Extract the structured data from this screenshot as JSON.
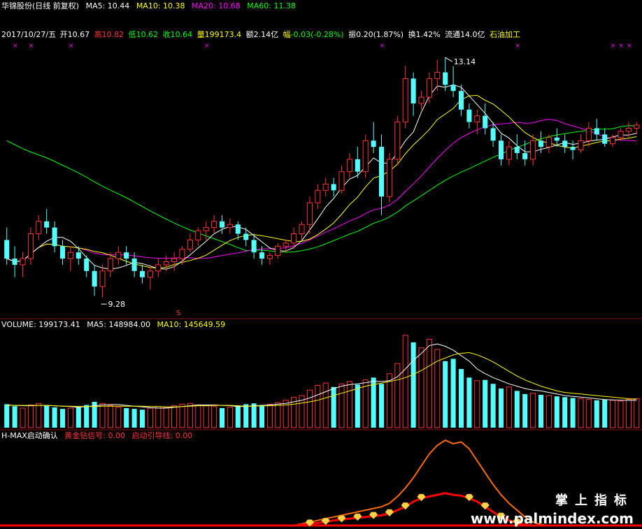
{
  "header": {
    "stock_title": "华锦股份(日线 前复权)",
    "ma5": "MA5: 10.44",
    "ma10": "MA10: 10.38",
    "ma20": "MA20: 10.68",
    "ma60": "MA60: 11.38"
  },
  "info_bar": {
    "date": "2017/10/27/五",
    "open_label": "开",
    "open": "10.67",
    "high_label": "高",
    "high": "10.82",
    "low_label": "低",
    "low": "10.62",
    "close_label": "收",
    "close": "10.64",
    "vol_label": "量",
    "vol": "199173.4",
    "amount_label": "额",
    "amount": "2.14亿",
    "change_label": "幅",
    "change": "-0.03(-0.28%)",
    "amp_label": "振",
    "amp": "0.20(1.87%)",
    "turnover_label": "换",
    "turnover": "1.42%",
    "float_label": "流通",
    "float": "14.0亿",
    "sector": "石油加工"
  },
  "volume_header": {
    "volume": "VOLUME: 199173.41",
    "ma5": "MA5: 148984.00",
    "ma10": "MA10: 145649.59"
  },
  "indicator_header": {
    "name": "H-MAX启动确认",
    "gold": "黄金钻信号: 0.00",
    "guide": "启动引导线: 0.00"
  },
  "annotations": {
    "high_marker": "13.14",
    "low_marker": "9.28",
    "s_marker": "S",
    "x_marker": "×"
  },
  "watermark": {
    "cn": "掌上指标",
    "url": "www.palmindex.com"
  },
  "colors": {
    "up": "#ff3232",
    "down": "#54ffff",
    "ma5": "#ffffff",
    "ma10": "#ffff00",
    "ma20": "#ff00ff",
    "ma60": "#00ff00",
    "guide_orange": "#ff6a00",
    "guide_red": "#ff0000",
    "diamond": "#ffd24a",
    "x_mark": "#ff00ff"
  },
  "chart_data": [
    {
      "type": "candlestick",
      "title": "华锦股份(日线 前复权)",
      "extremes": {
        "high": 13.14,
        "low": 9.28
      },
      "ohlc": [
        [
          10.2,
          10.4,
          9.8,
          9.9
        ],
        [
          9.9,
          10.1,
          9.6,
          9.8
        ],
        [
          9.8,
          10.0,
          9.6,
          9.9
        ],
        [
          9.9,
          10.4,
          9.8,
          10.3
        ],
        [
          10.3,
          10.6,
          10.2,
          10.5
        ],
        [
          10.5,
          10.7,
          10.3,
          10.4
        ],
        [
          10.4,
          10.5,
          10.0,
          10.1
        ],
        [
          10.1,
          10.2,
          9.8,
          9.9
        ],
        [
          9.9,
          10.1,
          9.7,
          10.0
        ],
        [
          10.0,
          10.1,
          9.8,
          9.9
        ],
        [
          9.9,
          9.95,
          9.6,
          9.7
        ],
        [
          9.7,
          9.8,
          9.3,
          9.45
        ],
        [
          9.45,
          9.8,
          9.28,
          9.7
        ],
        [
          9.7,
          10.0,
          9.6,
          9.9
        ],
        [
          9.9,
          10.1,
          9.8,
          10.0
        ],
        [
          10.0,
          10.1,
          9.8,
          9.9
        ],
        [
          9.9,
          10.0,
          9.6,
          9.7
        ],
        [
          9.7,
          9.8,
          9.5,
          9.6
        ],
        [
          9.6,
          9.8,
          9.4,
          9.7
        ],
        [
          9.7,
          9.9,
          9.6,
          9.8
        ],
        [
          9.8,
          9.95,
          9.7,
          9.85
        ],
        [
          9.85,
          10.0,
          9.7,
          9.9
        ],
        [
          9.9,
          10.1,
          9.8,
          10.05
        ],
        [
          10.05,
          10.3,
          10.0,
          10.2
        ],
        [
          10.2,
          10.4,
          10.1,
          10.35
        ],
        [
          10.35,
          10.5,
          10.2,
          10.4
        ],
        [
          10.4,
          10.6,
          10.3,
          10.5
        ],
        [
          10.5,
          10.6,
          10.3,
          10.4
        ],
        [
          10.4,
          10.55,
          10.3,
          10.45
        ],
        [
          10.45,
          10.5,
          10.2,
          10.3
        ],
        [
          10.3,
          10.4,
          10.1,
          10.2
        ],
        [
          10.2,
          10.3,
          9.9,
          10.0
        ],
        [
          10.0,
          10.1,
          9.8,
          9.9
        ],
        [
          9.9,
          10.0,
          9.8,
          9.95
        ],
        [
          9.95,
          10.15,
          9.9,
          10.1
        ],
        [
          10.1,
          10.2,
          10.0,
          10.15
        ],
        [
          10.15,
          10.4,
          10.05,
          10.3
        ],
        [
          10.3,
          10.5,
          10.2,
          10.45
        ],
        [
          10.45,
          10.9,
          10.3,
          10.8
        ],
        [
          10.8,
          11.1,
          10.7,
          11.0
        ],
        [
          11.0,
          11.2,
          10.9,
          11.1
        ],
        [
          11.1,
          11.2,
          10.9,
          11.0
        ],
        [
          11.0,
          11.4,
          10.95,
          11.3
        ],
        [
          11.3,
          11.6,
          11.2,
          11.5
        ],
        [
          11.5,
          11.7,
          11.2,
          11.3
        ],
        [
          11.3,
          11.9,
          11.2,
          11.8
        ],
        [
          11.8,
          12.1,
          11.6,
          11.7
        ],
        [
          11.7,
          11.9,
          10.6,
          10.9
        ],
        [
          10.9,
          11.6,
          10.8,
          11.5
        ],
        [
          11.5,
          12.2,
          11.4,
          12.1
        ],
        [
          12.1,
          13.0,
          12.0,
          12.8
        ],
        [
          12.8,
          12.9,
          12.2,
          12.4
        ],
        [
          12.4,
          12.6,
          12.3,
          12.5
        ],
        [
          12.5,
          12.9,
          12.4,
          12.8
        ],
        [
          12.8,
          13.1,
          12.6,
          12.9
        ],
        [
          12.9,
          13.14,
          12.6,
          12.7
        ],
        [
          12.7,
          13.0,
          12.5,
          12.6
        ],
        [
          12.6,
          12.7,
          12.2,
          12.3
        ],
        [
          12.3,
          12.4,
          12.0,
          12.1
        ],
        [
          12.1,
          12.3,
          11.9,
          12.2
        ],
        [
          12.2,
          12.4,
          11.9,
          12.0
        ],
        [
          12.0,
          12.1,
          11.7,
          11.8
        ],
        [
          11.8,
          11.9,
          11.4,
          11.5
        ],
        [
          11.5,
          11.8,
          11.4,
          11.7
        ],
        [
          11.7,
          11.9,
          11.5,
          11.6
        ],
        [
          11.6,
          11.8,
          11.4,
          11.5
        ],
        [
          11.5,
          11.9,
          11.4,
          11.8
        ],
        [
          11.8,
          11.95,
          11.6,
          11.7
        ],
        [
          11.7,
          11.9,
          11.6,
          11.85
        ],
        [
          11.85,
          12.0,
          11.7,
          11.8
        ],
        [
          11.8,
          11.9,
          11.6,
          11.7
        ],
        [
          11.7,
          11.8,
          11.5,
          11.65
        ],
        [
          11.65,
          11.9,
          11.6,
          11.8
        ],
        [
          11.8,
          12.1,
          11.7,
          12.0
        ],
        [
          12.0,
          12.15,
          11.8,
          11.9
        ],
        [
          11.9,
          12.0,
          11.7,
          11.75
        ],
        [
          11.75,
          11.9,
          11.7,
          11.85
        ],
        [
          11.85,
          12.0,
          11.8,
          11.95
        ],
        [
          11.95,
          12.1,
          11.85,
          12.0
        ],
        [
          12.0,
          12.1,
          11.9,
          12.05
        ]
      ]
    },
    {
      "type": "bar",
      "title": "VOLUME",
      "values": [
        60,
        55,
        50,
        58,
        62,
        56,
        52,
        48,
        50,
        54,
        58,
        66,
        62,
        57,
        52,
        50,
        48,
        46,
        50,
        54,
        52,
        56,
        60,
        62,
        58,
        56,
        54,
        50,
        52,
        56,
        60,
        62,
        58,
        60,
        64,
        70,
        78,
        82,
        96,
        108,
        114,
        104,
        112,
        118,
        110,
        122,
        128,
        112,
        138,
        164,
        236,
        218,
        204,
        226,
        200,
        170,
        176,
        150,
        128,
        120,
        122,
        112,
        100,
        104,
        94,
        86,
        88,
        84,
        82,
        80,
        78,
        76,
        74,
        72,
        70,
        72,
        70,
        68,
        72,
        74
      ],
      "ma5": [
        58,
        57,
        56,
        56,
        57,
        57,
        56,
        55,
        54,
        52,
        54,
        56,
        58,
        59,
        59,
        57,
        55,
        53,
        51,
        50,
        50,
        52,
        54,
        56,
        58,
        58,
        58,
        57,
        56,
        54,
        54,
        56,
        57,
        58,
        60,
        62,
        66,
        70,
        76,
        84,
        92,
        100,
        106,
        110,
        112,
        115,
        118,
        118,
        120,
        130,
        150,
        172,
        190,
        210,
        214,
        208,
        198,
        184,
        170,
        150,
        138,
        128,
        120,
        112,
        106,
        100,
        96,
        94,
        90,
        86,
        82,
        80,
        78,
        76,
        74,
        72,
        71,
        70,
        70,
        70
      ],
      "ma10": [
        57,
        57,
        57,
        57,
        57,
        57,
        56,
        55,
        55,
        54,
        54,
        54,
        55,
        55,
        55,
        55,
        55,
        55,
        54,
        54,
        53,
        53,
        54,
        55,
        56,
        56,
        57,
        57,
        57,
        56,
        55,
        55,
        56,
        56,
        57,
        58,
        60,
        63,
        66,
        70,
        76,
        82,
        88,
        94,
        100,
        106,
        110,
        114,
        118,
        122,
        128,
        136,
        146,
        158,
        170,
        178,
        186,
        190,
        192,
        186,
        178,
        168,
        156,
        144,
        132,
        122,
        114,
        106,
        100,
        94,
        90,
        88,
        86,
        84,
        82,
        80,
        78,
        76,
        74,
        73
      ]
    },
    {
      "type": "line",
      "title": "H-MAX启动确认",
      "series": [
        {
          "name": "启动引导线",
          "values": [
            0,
            0,
            0,
            0,
            0,
            0,
            0,
            0,
            0,
            0,
            0,
            0,
            0,
            0,
            0,
            0,
            0,
            0,
            0,
            0,
            0,
            0,
            0,
            0,
            0,
            0,
            0,
            0,
            0,
            0,
            0,
            0,
            0,
            0,
            0,
            0,
            0,
            0.02,
            0.04,
            0.06,
            0.08,
            0.1,
            0.12,
            0.14,
            0.16,
            0.18,
            0.2,
            0.22,
            0.26,
            0.34,
            0.44,
            0.56,
            0.7,
            0.84,
            0.94,
            1.0,
            0.96,
            0.98,
            0.9,
            0.76,
            0.62,
            0.48,
            0.36,
            0.26,
            0.18,
            0.1,
            0.04,
            0.01,
            0,
            0,
            0,
            0,
            0,
            0,
            0,
            0,
            0,
            0,
            0,
            0
          ]
        },
        {
          "name": "黄金钻信号",
          "values": [
            0,
            0,
            0,
            0,
            0,
            0,
            0,
            0,
            0,
            0,
            0,
            0,
            0,
            0,
            0,
            0,
            0,
            0,
            0,
            0,
            0,
            0,
            0,
            0,
            0,
            0,
            0,
            0,
            0,
            0,
            0,
            0,
            0,
            0,
            0,
            0,
            0,
            0.01,
            0.02,
            0.03,
            0.04,
            0.06,
            0.07,
            0.08,
            0.09,
            0.1,
            0.11,
            0.12,
            0.14,
            0.18,
            0.22,
            0.28,
            0.32,
            0.34,
            0.36,
            0.38,
            0.36,
            0.35,
            0.32,
            0.28,
            0.22,
            0.16,
            0.1,
            0.06,
            0.03,
            0.01,
            0,
            0,
            0,
            0,
            0,
            0,
            0,
            0,
            0,
            0,
            0,
            0,
            0,
            0
          ]
        }
      ]
    }
  ]
}
